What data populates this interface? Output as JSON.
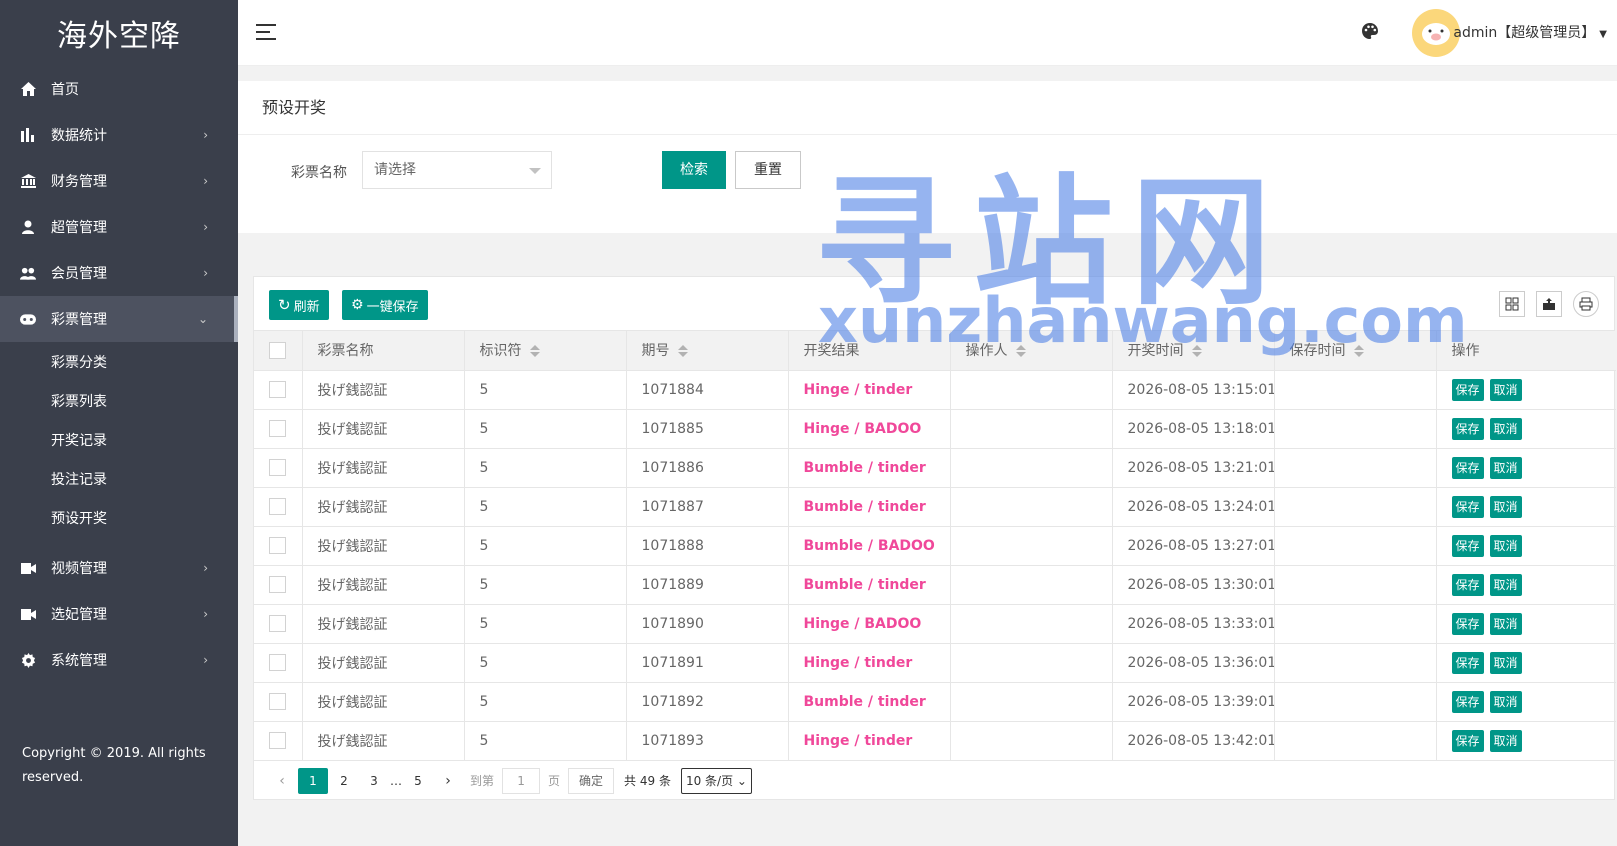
{
  "app": {
    "logo": "海外空降"
  },
  "sidebar": {
    "items": [
      {
        "label": "首页",
        "icon": "home-icon",
        "has_sub": false
      },
      {
        "label": "数据统计",
        "icon": "bar-chart-icon",
        "has_sub": true
      },
      {
        "label": "财务管理",
        "icon": "bank-icon",
        "has_sub": true
      },
      {
        "label": "超管管理",
        "icon": "user-icon",
        "has_sub": true
      },
      {
        "label": "会员管理",
        "icon": "users-icon",
        "has_sub": true
      },
      {
        "label": "彩票管理",
        "icon": "gamepad-icon",
        "has_sub": true,
        "expanded": true
      }
    ],
    "sub_items": [
      "彩票分类",
      "彩票列表",
      "开奖记录",
      "投注记录",
      "预设开奖"
    ],
    "items_after": [
      {
        "label": "视频管理",
        "icon": "video-icon"
      },
      {
        "label": "选妃管理",
        "icon": "video-icon"
      },
      {
        "label": "系统管理",
        "icon": "gear-icon"
      }
    ],
    "copyright_line1": "Copyright © 2019. All rights",
    "copyright_line2": "reserved."
  },
  "header": {
    "user": "admin【超级管理员】"
  },
  "page": {
    "title": "预设开奖"
  },
  "search": {
    "label": "彩票名称",
    "placeholder": "请选择",
    "search_label": "检索",
    "reset_label": "重置"
  },
  "toolbar": {
    "refresh_label": "刷新",
    "save_all_label": "一键保存"
  },
  "table": {
    "columns": [
      "彩票名称",
      "标识符",
      "期号",
      "开奖结果",
      "操作人",
      "开奖时间",
      "保存时间",
      "操作"
    ],
    "rows": [
      {
        "name": "投げ銭認証",
        "id": "5",
        "issue": "1071884",
        "result": "Hinge / tinder",
        "operator": "",
        "time": "2026-08-05 13:15:01",
        "saved": ""
      },
      {
        "name": "投げ銭認証",
        "id": "5",
        "issue": "1071885",
        "result": "Hinge / BADOO",
        "operator": "",
        "time": "2026-08-05 13:18:01",
        "saved": ""
      },
      {
        "name": "投げ銭認証",
        "id": "5",
        "issue": "1071886",
        "result": "Bumble / tinder",
        "operator": "",
        "time": "2026-08-05 13:21:01",
        "saved": ""
      },
      {
        "name": "投げ銭認証",
        "id": "5",
        "issue": "1071887",
        "result": "Bumble / tinder",
        "operator": "",
        "time": "2026-08-05 13:24:01",
        "saved": ""
      },
      {
        "name": "投げ銭認証",
        "id": "5",
        "issue": "1071888",
        "result": "Bumble / BADOO",
        "operator": "",
        "time": "2026-08-05 13:27:01",
        "saved": ""
      },
      {
        "name": "投げ銭認証",
        "id": "5",
        "issue": "1071889",
        "result": "Bumble / tinder",
        "operator": "",
        "time": "2026-08-05 13:30:01",
        "saved": ""
      },
      {
        "name": "投げ銭認証",
        "id": "5",
        "issue": "1071890",
        "result": "Hinge / BADOO",
        "operator": "",
        "time": "2026-08-05 13:33:01",
        "saved": ""
      },
      {
        "name": "投げ銭認証",
        "id": "5",
        "issue": "1071891",
        "result": "Hinge / tinder",
        "operator": "",
        "time": "2026-08-05 13:36:01",
        "saved": ""
      },
      {
        "name": "投げ銭認証",
        "id": "5",
        "issue": "1071892",
        "result": "Bumble / tinder",
        "operator": "",
        "time": "2026-08-05 13:39:01",
        "saved": ""
      },
      {
        "name": "投げ銭認証",
        "id": "5",
        "issue": "1071893",
        "result": "Hinge / tinder",
        "operator": "",
        "time": "2026-08-05 13:42:01",
        "saved": ""
      }
    ],
    "save_label": "保存",
    "cancel_label": "取消"
  },
  "pagination": {
    "current": "1",
    "pages": [
      "2",
      "3"
    ],
    "ellipsis": "…",
    "last": "5",
    "goto_prefix": "到第",
    "goto_value": "1",
    "goto_suffix": "页",
    "confirm": "确定",
    "total": "共 49 条",
    "page_size": "10 条/页"
  },
  "watermark": {
    "line1": "寻站网",
    "line2": "xunzhanwang.com"
  },
  "colors": {
    "sidebar": "#3a3f4b",
    "accent": "#009688",
    "result": "#f0489a"
  }
}
